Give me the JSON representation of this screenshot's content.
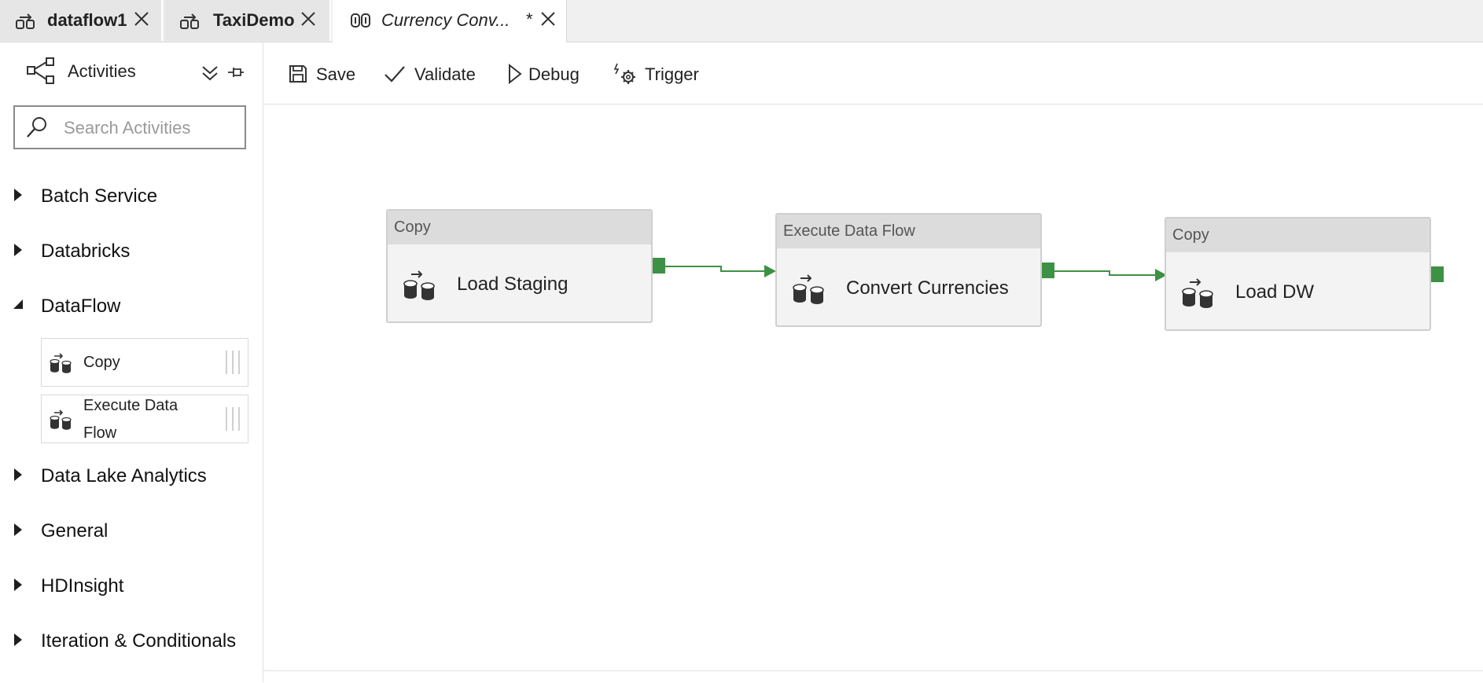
{
  "tabs": [
    {
      "label": "dataflow1",
      "active": false,
      "icon": "pipeline-icon"
    },
    {
      "label": "TaxiDemo",
      "active": false,
      "icon": "pipeline-icon"
    },
    {
      "label": "Currency Conv...",
      "active": true,
      "dirty_marker": "*",
      "icon": "dataflow-icon"
    }
  ],
  "sidebar": {
    "title": "Activities",
    "search": {
      "placeholder": "Search Activities",
      "value": ""
    },
    "categories": [
      {
        "label": "Batch Service",
        "expanded": false
      },
      {
        "label": "Databricks",
        "expanded": false
      },
      {
        "label": "DataFlow",
        "expanded": true,
        "items": [
          {
            "label": "Copy",
            "icon": "copy-activity-icon"
          },
          {
            "label": "Execute Data Flow",
            "icon": "copy-activity-icon"
          }
        ]
      },
      {
        "label": "Data Lake Analytics",
        "expanded": false
      },
      {
        "label": "General",
        "expanded": false
      },
      {
        "label": "HDInsight",
        "expanded": false
      },
      {
        "label": "Iteration & Conditionals",
        "expanded": false
      }
    ]
  },
  "toolbar": {
    "save_label": "Save",
    "validate_label": "Validate",
    "debug_label": "Debug",
    "trigger_label": "Trigger"
  },
  "canvas": {
    "nodes": [
      {
        "type": "Copy",
        "name": "Load Staging"
      },
      {
        "type": "Execute Data Flow",
        "name": "Convert Currencies"
      },
      {
        "type": "Copy",
        "name": "Load DW"
      }
    ],
    "connector_color": "#3d9144"
  }
}
